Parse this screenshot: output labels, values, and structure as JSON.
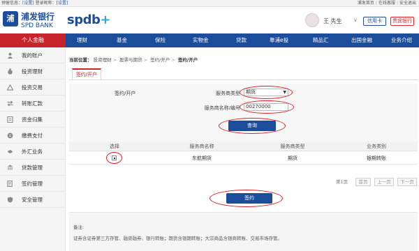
{
  "topbar": {
    "left_text": "预留信息：",
    "left_link1": "[设置]",
    "left_text2": "登录昵称：",
    "left_link2": "[设置]",
    "right_home": "浦发首页",
    "right_service": "在线客服",
    "right_logout": "安全退出"
  },
  "header": {
    "logo_mark": "浦",
    "logo_cn": "浦发银行",
    "logo_en": "SPD BANK",
    "brand": "spdb",
    "brand_plus": "+",
    "user_name": "王  先生",
    "user_arrow": "∨",
    "card_btn": "信用卡",
    "bank_btn": "贵宾银行"
  },
  "nav": {
    "personal": "个人金融",
    "items": [
      "理财",
      "基金",
      "保险",
      "实物金",
      "贷款",
      "靠浦e投",
      "精品汇",
      "出国金融",
      "业务介绍"
    ]
  },
  "sidebar": {
    "items": [
      "我的账户",
      "投资理财",
      "投资交易",
      "转账汇款",
      "资金归集",
      "缴费支付",
      "外汇业务",
      "贷款管理",
      "签约管理",
      "安全管理"
    ]
  },
  "breadcrumb": {
    "label": "当前位置：",
    "parts": [
      "投资理财",
      "股票与期货",
      "签约/开户"
    ],
    "current": "签约/开户"
  },
  "tab": {
    "label": "签约/开户"
  },
  "form": {
    "title": "签约/开户",
    "type_label": "服务商类型",
    "type_value": "期货",
    "name_label": "服务商名称/编号",
    "name_value": "00270000",
    "query_btn": "查询"
  },
  "table": {
    "headers": [
      "选择",
      "服务商名称",
      "服务商类型",
      "业务类别"
    ],
    "rows": [
      {
        "name": "东航期货",
        "type": "期货",
        "category": "银期转账"
      }
    ]
  },
  "pager": {
    "page_text": "第1页",
    "buttons": [
      "首页",
      "上一页",
      "下一页"
    ]
  },
  "sign_btn": "签约",
  "note": {
    "title": "备注:",
    "text": "证券含证券第三方存管、融资融券、银行转账；期货含银期转账；大宗商品含银商转账、交易市场存管。"
  },
  "colors": {
    "brand_blue": "#1b4d9b",
    "accent_red": "#c7232a",
    "highlight_ring": "#d6232a"
  }
}
